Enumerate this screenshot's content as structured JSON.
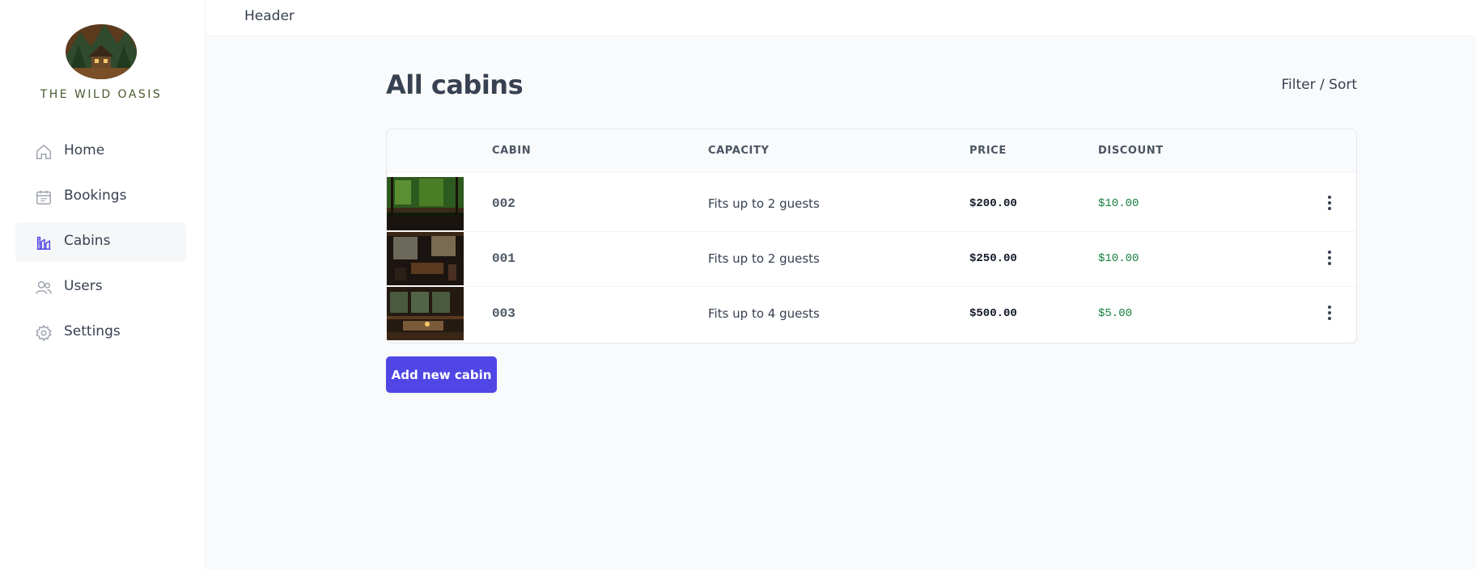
{
  "brand": {
    "name": "THE WILD OASIS"
  },
  "sidebar": {
    "items": [
      {
        "label": "Home",
        "icon": "home-icon",
        "active": false
      },
      {
        "label": "Bookings",
        "icon": "calendar-icon",
        "active": false
      },
      {
        "label": "Cabins",
        "icon": "cabins-icon",
        "active": true
      },
      {
        "label": "Users",
        "icon": "users-icon",
        "active": false
      },
      {
        "label": "Settings",
        "icon": "gear-icon",
        "active": false
      }
    ]
  },
  "header": {
    "text": "Header"
  },
  "main": {
    "title": "All cabins",
    "filter_sort": "Filter / Sort",
    "add_button": "Add new cabin"
  },
  "table": {
    "columns": [
      "CABIN",
      "CAPACITY",
      "PRICE",
      "DISCOUNT"
    ],
    "rows": [
      {
        "cabin": "002",
        "capacity": "Fits up to 2 guests",
        "price": "$200.00",
        "discount": "$10.00"
      },
      {
        "cabin": "001",
        "capacity": "Fits up to 2 guests",
        "price": "$250.00",
        "discount": "$10.00"
      },
      {
        "cabin": "003",
        "capacity": "Fits up to 4 guests",
        "price": "$500.00",
        "discount": "$5.00"
      }
    ]
  },
  "colors": {
    "accent": "#4f46e5",
    "discount": "#15803d",
    "brand_text": "#4a5a2f"
  }
}
